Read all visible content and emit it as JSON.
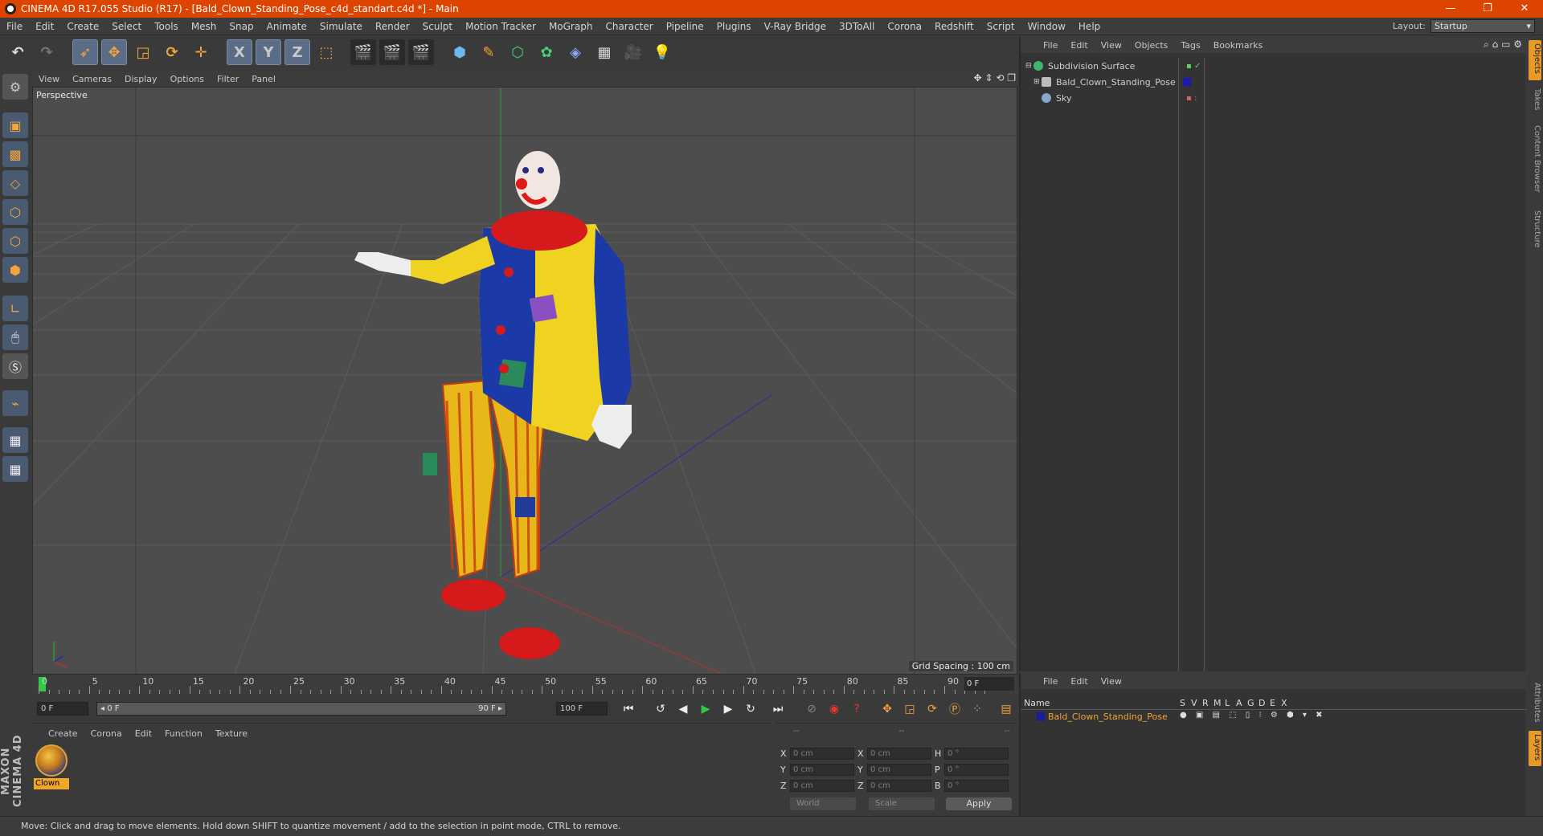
{
  "app": {
    "title": "CINEMA 4D R17.055 Studio (R17) - [Bald_Clown_Standing_Pose_c4d_standart.c4d *] - Main",
    "window_controls": [
      "—",
      "❐",
      "✕"
    ]
  },
  "menubar": {
    "items": [
      "File",
      "Edit",
      "Create",
      "Select",
      "Tools",
      "Mesh",
      "Snap",
      "Animate",
      "Simulate",
      "Render",
      "Sculpt",
      "Motion Tracker",
      "MoGraph",
      "Character",
      "Pipeline",
      "Plugins",
      "V-Ray Bridge",
      "3DToAll",
      "Corona",
      "Redshift",
      "Script",
      "Window",
      "Help"
    ],
    "layout_label": "Layout:",
    "layout_value": "Startup"
  },
  "toolbar": {
    "axis_x": "X",
    "axis_y": "Y",
    "axis_z": "Z"
  },
  "viewport": {
    "menu": [
      "View",
      "Cameras",
      "Display",
      "Options",
      "Filter",
      "Panel"
    ],
    "label": "Perspective",
    "grid_spacing": "Grid Spacing : 100 cm",
    "nav_icons": "✥ ⇕ ⟲ ❐"
  },
  "timeline": {
    "ticks": [
      "0",
      "5",
      "10",
      "15",
      "20",
      "25",
      "30",
      "35",
      "40",
      "45",
      "50",
      "55",
      "60",
      "65",
      "70",
      "75",
      "80",
      "85",
      "90"
    ],
    "current_frame": "0 F"
  },
  "transport": {
    "start": "0 F",
    "range_start": "◂ 0 F",
    "range_end": "90 F ▸",
    "end": "100 F"
  },
  "materials": {
    "menu": [
      "Create",
      "Corona",
      "Edit",
      "Function",
      "Texture"
    ],
    "items": [
      {
        "label": "Clown"
      }
    ]
  },
  "coordinates": {
    "header": [
      "--",
      "--",
      "--"
    ],
    "rows": [
      {
        "l1": "X",
        "v1": "0 cm",
        "l2": "X",
        "v2": "0 cm",
        "l3": "H",
        "v3": "0 °"
      },
      {
        "l1": "Y",
        "v1": "0 cm",
        "l2": "Y",
        "v2": "0 cm",
        "l3": "P",
        "v3": "0 °"
      },
      {
        "l1": "Z",
        "v1": "0 cm",
        "l2": "Z",
        "v2": "0 cm",
        "l3": "B",
        "v3": "0 °"
      }
    ],
    "mode": "World",
    "scale": "Scale",
    "apply": "Apply"
  },
  "objects": {
    "menu": [
      "File",
      "Edit",
      "View",
      "Objects",
      "Tags",
      "Bookmarks"
    ],
    "items": [
      {
        "name": "Subdivision Surface",
        "color": "#3fb56b"
      },
      {
        "name": "Bald_Clown_Standing_Pose",
        "color": "#bbbbbb"
      },
      {
        "name": "Sky",
        "color": "#8aa6c8"
      }
    ]
  },
  "layers": {
    "menu": [
      "File",
      "Edit",
      "View"
    ],
    "header": {
      "name": "Name",
      "cols": [
        "S",
        "V",
        "R",
        "M",
        "L",
        "A",
        "G",
        "D",
        "E",
        "X"
      ]
    },
    "items": [
      {
        "name": "Bald_Clown_Standing_Pose",
        "color": "#1a1aa0"
      }
    ]
  },
  "side_tabs": [
    "Objects",
    "Takes",
    "Content Browser",
    "Structure"
  ],
  "side_tabs_bottom": [
    "Attributes",
    "Layers"
  ],
  "maxon": "MAXON CINEMA 4D",
  "status": "Move: Click and drag to move elements. Hold down SHIFT to quantize movement / add to the selection in point mode, CTRL to remove.",
  "colors": {
    "title_bar": "#dd4400",
    "accent": "#e79a2a",
    "viewport_bg": "#4d4d4d"
  }
}
